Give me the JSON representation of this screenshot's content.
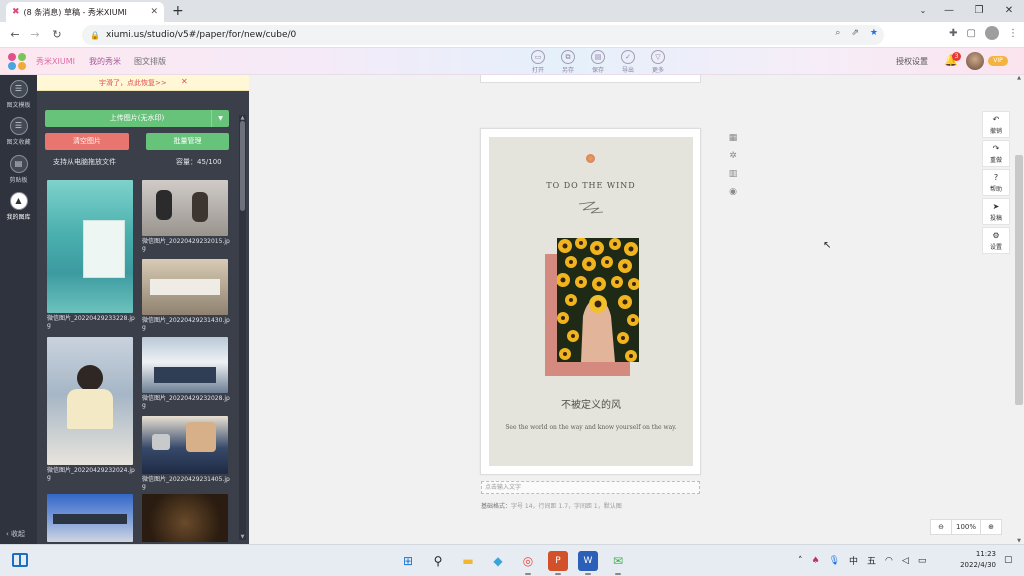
{
  "browser": {
    "tab_title": "(8 条消息) 草稿 - 秀米XIUMI",
    "url": "xiumi.us/studio/v5#/paper/for/new/cube/0"
  },
  "header": {
    "brand": "秀米XIUMI",
    "nav": [
      "我的秀米",
      "图文排版"
    ],
    "tools": [
      {
        "label": "打开",
        "icon": "folder-icon"
      },
      {
        "label": "另存",
        "icon": "save-as-icon"
      },
      {
        "label": "保存",
        "icon": "save-icon"
      },
      {
        "label": "导出",
        "icon": "check-icon"
      },
      {
        "label": "更多",
        "icon": "more-icon"
      }
    ],
    "auth_settings": "授权设置",
    "notification_count": "3",
    "vip_badge": "VIP"
  },
  "rail": {
    "items": [
      "图文模板",
      "图文收藏",
      "剪贴板",
      "我的图库"
    ],
    "active_index": 3,
    "collapse": "收起"
  },
  "panel": {
    "tooltip": "宇滑了，点此恢复>>",
    "upload": "上传图片(无水印)",
    "clear": "清空图片",
    "batch": "批量管理",
    "drag_hint": "支持从电脑拖放文件",
    "capacity": "容量：45/100",
    "images": [
      {
        "caption": "微信图片_20220429233228.jpg",
        "color": "#5fb9b5"
      },
      {
        "caption": "微信图片_20220429232015.jpg",
        "color": "#b7b2ad"
      },
      {
        "caption": "微信图片_20220429231430.jpg",
        "color": "#a89a86"
      },
      {
        "caption": "微信图片_20220429232024.jpg",
        "color": "#a7b4c5"
      },
      {
        "caption": "微信图片_20220429232028.jpg",
        "color": "#8fa2b6"
      },
      {
        "caption": "微信图片_20220429231405.jpg",
        "color": "#384a6a"
      },
      {
        "caption": "",
        "color": "#6a8bc8"
      },
      {
        "caption": "",
        "color": "#4a3420"
      }
    ]
  },
  "poster": {
    "title_en": "TO DO THE WIND",
    "title_zh": "不被定义的风",
    "subtitle_en": "See the world on the way and know yourself on the way."
  },
  "editor": {
    "text_placeholder": "点击输入文字",
    "format_label": "基础格式：",
    "format_values": "字号 14，行间距 1.7，字间距 1，默认图"
  },
  "right_tools": [
    {
      "label": "撤销",
      "icon": "undo-icon"
    },
    {
      "label": "重做",
      "icon": "redo-icon"
    },
    {
      "label": "帮助",
      "icon": "help-icon"
    },
    {
      "label": "投稿",
      "icon": "send-icon"
    },
    {
      "label": "设置",
      "icon": "settings-icon"
    }
  ],
  "zoom": {
    "value": "100%"
  },
  "taskbar": {
    "time": "11:23",
    "date": "2022/4/30",
    "ime": "中",
    "ime_mode": "五"
  }
}
